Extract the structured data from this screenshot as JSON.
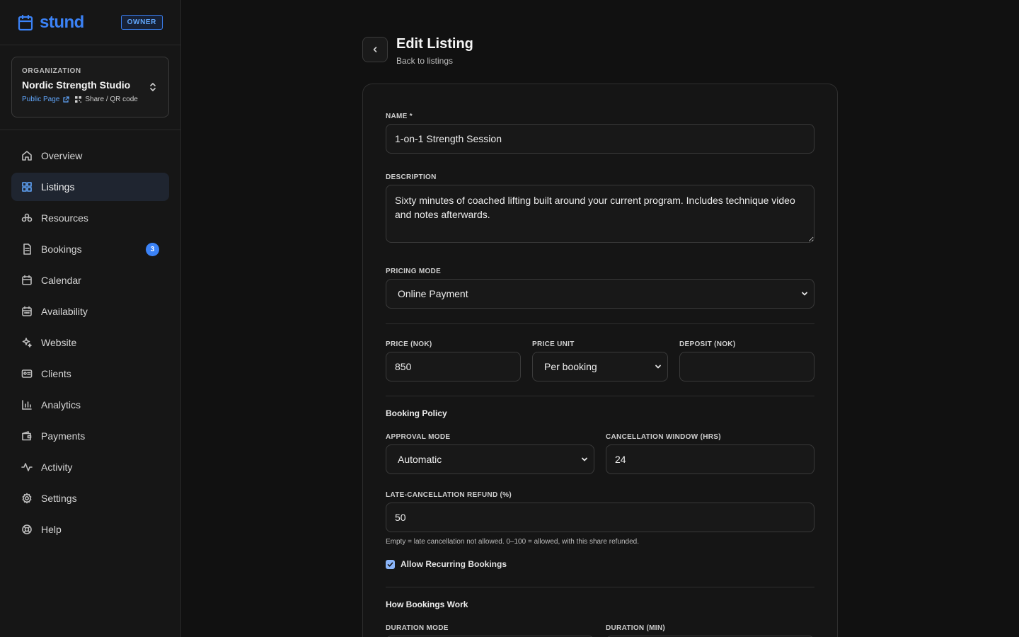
{
  "brand": {
    "name": "stund",
    "role_badge": "OWNER"
  },
  "organization": {
    "label": "ORGANIZATION",
    "name": "Nordic Strength Studio",
    "public_page": "Public Page",
    "share": "Share / QR code"
  },
  "nav": {
    "items": [
      {
        "label": "Overview",
        "icon": "home-icon"
      },
      {
        "label": "Listings",
        "icon": "grid-icon",
        "active": true
      },
      {
        "label": "Resources",
        "icon": "users-icon"
      },
      {
        "label": "Bookings",
        "icon": "file-icon",
        "badge": "3"
      },
      {
        "label": "Calendar",
        "icon": "calendar-icon"
      },
      {
        "label": "Availability",
        "icon": "calendar-days-icon"
      },
      {
        "label": "Website",
        "icon": "sparkles-icon"
      },
      {
        "label": "Clients",
        "icon": "id-card-icon"
      },
      {
        "label": "Analytics",
        "icon": "bar-chart-icon"
      },
      {
        "label": "Payments",
        "icon": "wallet-icon"
      },
      {
        "label": "Activity",
        "icon": "pulse-icon"
      },
      {
        "label": "Settings",
        "icon": "gear-icon"
      },
      {
        "label": "Help",
        "icon": "lifebuoy-icon"
      }
    ]
  },
  "page": {
    "title": "Edit Listing",
    "subtitle": "Back to listings"
  },
  "form": {
    "name": {
      "label": "NAME *",
      "value": "1-on-1 Strength Session"
    },
    "description": {
      "label": "DESCRIPTION",
      "value": "Sixty minutes of coached lifting built around your current program. Includes technique video and notes afterwards."
    },
    "pricing_mode": {
      "label": "PRICING MODE",
      "value": "Online Payment"
    },
    "price": {
      "label": "PRICE (NOK)",
      "value": "850"
    },
    "price_unit": {
      "label": "PRICE UNIT",
      "value": "Per booking"
    },
    "deposit": {
      "label": "DEPOSIT (NOK)",
      "value": ""
    },
    "booking_policy": {
      "title": "Booking Policy"
    },
    "approval_mode": {
      "label": "APPROVAL MODE",
      "value": "Automatic"
    },
    "cancellation_window": {
      "label": "CANCELLATION WINDOW (HRS)",
      "value": "24"
    },
    "late_refund": {
      "label": "LATE-CANCELLATION REFUND (%)",
      "value": "50",
      "hint": "Empty = late cancellation not allowed. 0–100 = allowed, with this share refunded."
    },
    "recurring": {
      "label": "Allow Recurring Bookings",
      "checked": true
    },
    "how_bookings_work": {
      "title": "How Bookings Work"
    },
    "duration_mode": {
      "label": "DURATION MODE"
    },
    "duration": {
      "label": "DURATION (MIN)"
    }
  },
  "colors": {
    "accent": "#3b82f6",
    "background": "#111111",
    "sidebar": "#161616"
  }
}
